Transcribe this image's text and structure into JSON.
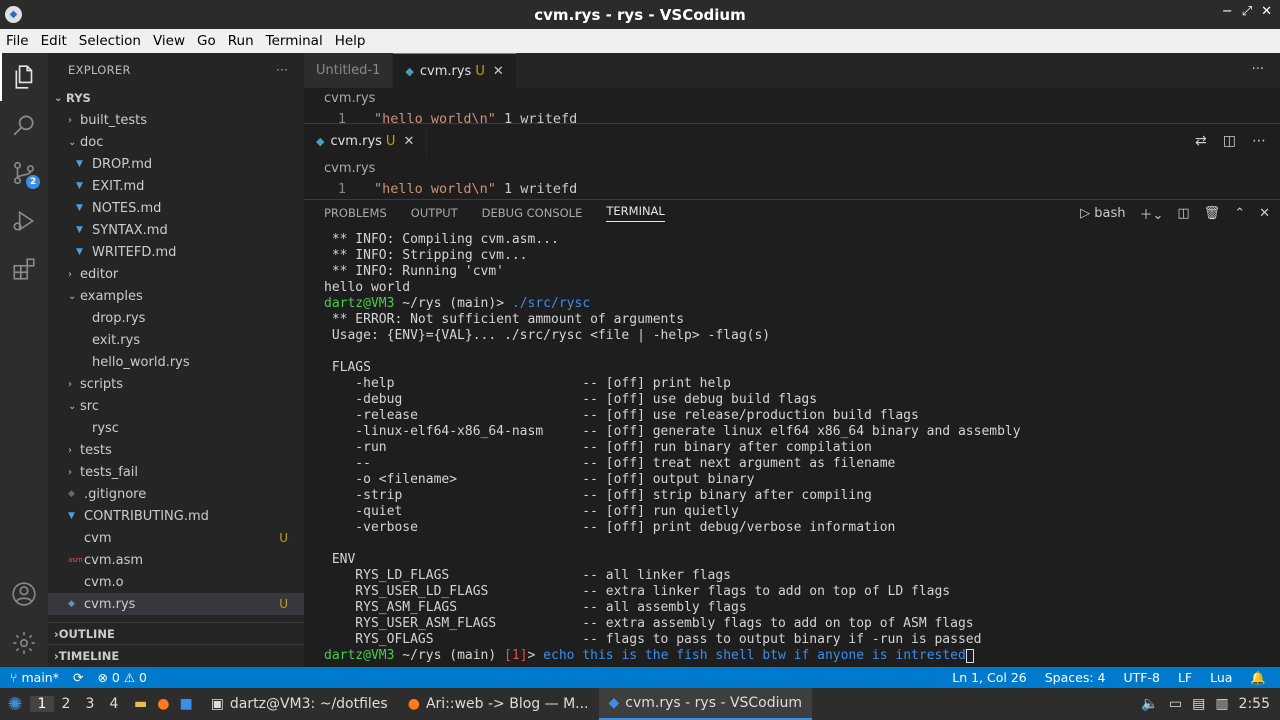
{
  "window": {
    "title": "cvm.rys - rys - VSCodium",
    "min": "−",
    "restore": "⤢",
    "close": "✕"
  },
  "menu": [
    "File",
    "Edit",
    "Selection",
    "View",
    "Go",
    "Run",
    "Terminal",
    "Help"
  ],
  "activity": {
    "scm_badge": "2"
  },
  "explorer": {
    "title": "EXPLORER",
    "more": "···",
    "root": "RYS",
    "items": [
      {
        "label": "built_tests",
        "type": "folder",
        "depth": 1,
        "open": false
      },
      {
        "label": "doc",
        "type": "folder",
        "depth": 1,
        "open": true
      },
      {
        "label": "DROP.md",
        "type": "md",
        "depth": 2
      },
      {
        "label": "EXIT.md",
        "type": "md",
        "depth": 2
      },
      {
        "label": "NOTES.md",
        "type": "md",
        "depth": 2
      },
      {
        "label": "SYNTAX.md",
        "type": "md",
        "depth": 2
      },
      {
        "label": "WRITEFD.md",
        "type": "md",
        "depth": 2
      },
      {
        "label": "editor",
        "type": "folder",
        "depth": 1,
        "open": false
      },
      {
        "label": "examples",
        "type": "folder",
        "depth": 1,
        "open": true
      },
      {
        "label": "drop.rys",
        "type": "file",
        "depth": 2
      },
      {
        "label": "exit.rys",
        "type": "file",
        "depth": 2
      },
      {
        "label": "hello_world.rys",
        "type": "file",
        "depth": 2
      },
      {
        "label": "scripts",
        "type": "folder",
        "depth": 1,
        "open": false
      },
      {
        "label": "src",
        "type": "folder",
        "depth": 1,
        "open": true
      },
      {
        "label": "rysc",
        "type": "file",
        "depth": 2
      },
      {
        "label": "tests",
        "type": "folder",
        "depth": 1,
        "open": false
      },
      {
        "label": "tests_fail",
        "type": "folder",
        "depth": 1,
        "open": false
      },
      {
        "label": ".gitignore",
        "type": "git",
        "depth": 1
      },
      {
        "label": "CONTRIBUTING.md",
        "type": "md",
        "depth": 1
      },
      {
        "label": "cvm",
        "type": "file",
        "depth": 1,
        "status": "U"
      },
      {
        "label": "cvm.asm",
        "type": "asm",
        "depth": 1
      },
      {
        "label": "cvm.o",
        "type": "file",
        "depth": 1
      },
      {
        "label": "cvm.rys",
        "type": "rys",
        "depth": 1,
        "status": "U",
        "selected": true
      }
    ],
    "outline": "OUTLINE",
    "timeline": "TIMELINE"
  },
  "editor": {
    "group1": {
      "tabs": [
        {
          "label": "Untitled-1",
          "active": false
        },
        {
          "label": "cvm.rys",
          "status": "U",
          "active": true
        }
      ],
      "breadcrumb": "cvm.rys",
      "line_no": "1",
      "code_str": "\"hello world\\n\"",
      "code_rest": " 1 writefd"
    },
    "group2": {
      "tab": "cvm.rys",
      "status": "U",
      "breadcrumb": "cvm.rys",
      "line_no": "1",
      "code_str": "\"hello world\\n\"",
      "code_rest": " 1 writefd"
    },
    "more": "···"
  },
  "panel": {
    "tabs": [
      "PROBLEMS",
      "OUTPUT",
      "DEBUG CONSOLE",
      "TERMINAL"
    ],
    "shell": "bash",
    "terminal": [
      " ** INFO: Compiling cvm.asm...",
      " ** INFO: Stripping cvm...",
      " ** INFO: Running 'cvm'",
      "hello world",
      "__PROMPT1__",
      " ** ERROR: Not sufficient ammount of arguments",
      " Usage: {ENV}={VAL}... ./src/rysc <file | -help> -flag(s)",
      "",
      " FLAGS",
      "    -help                        -- [off] print help",
      "    -debug                       -- [off] use debug build flags",
      "    -release                     -- [off] use release/production build flags",
      "    -linux-elf64-x86_64-nasm     -- [off] generate linux elf64 x86_64 binary and assembly",
      "    -run                         -- [off] run binary after compilation",
      "    --                           -- [off] treat next argument as filename",
      "    -o <filename>                -- [off] output binary",
      "    -strip                       -- [off] strip binary after compiling",
      "    -quiet                       -- [off] run quietly",
      "    -verbose                     -- [off] print debug/verbose information",
      "",
      " ENV",
      "    RYS_LD_FLAGS                 -- all linker flags",
      "    RYS_USER_LD_FLAGS            -- extra linker flags to add on top of LD flags",
      "    RYS_ASM_FLAGS                -- all assembly flags",
      "    RYS_USER_ASM_FLAGS           -- extra assembly flags to add on top of ASM flags",
      "    RYS_OFLAGS                   -- flags to pass to output binary if -run is passed"
    ],
    "prompt1": {
      "user": "dartz@VM3",
      "path": " ~/rys",
      "branch": " (main)>",
      "cmd": " ./src/rysc"
    },
    "prompt2": {
      "user": "dartz@VM3",
      "path": " ~/rys",
      "branch": " (main)",
      "status": " [1]",
      "gt": ">",
      "cmd": " echo this is the fish shell btw if anyone is intrested"
    }
  },
  "status": {
    "branch": "main*",
    "errors": "0",
    "warnings": "0",
    "position": "Ln 1, Col 26",
    "spaces": "Spaces: 4",
    "encoding": "UTF-8",
    "eol": "LF",
    "lang": "Lua"
  },
  "taskbar": {
    "workspaces": [
      "1",
      "2",
      "3",
      "4"
    ],
    "apps": [
      {
        "label": "dartz@VM3: ~/dotfiles",
        "active": false
      },
      {
        "label": "Ari::web -> Blog — M...",
        "active": false
      },
      {
        "label": "cvm.rys - rys - VSCodium",
        "active": true
      }
    ],
    "clock": "2:55"
  }
}
